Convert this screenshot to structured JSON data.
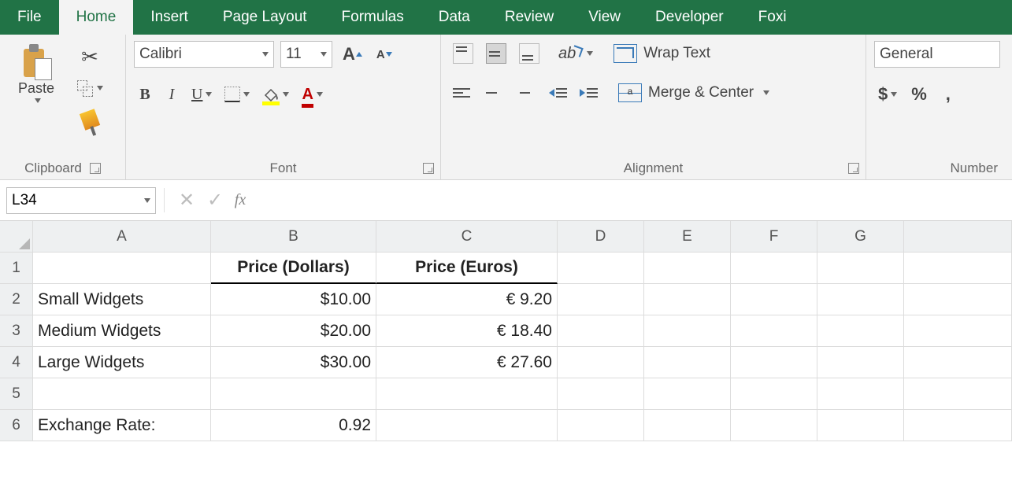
{
  "tabs": {
    "file": "File",
    "home": "Home",
    "insert": "Insert",
    "page_layout": "Page Layout",
    "formulas": "Formulas",
    "data": "Data",
    "review": "Review",
    "view": "View",
    "developer": "Developer",
    "foxit": "Foxi"
  },
  "ribbon": {
    "clipboard": {
      "label": "Clipboard",
      "paste": "Paste"
    },
    "font": {
      "label": "Font",
      "name": "Calibri",
      "size": "11",
      "grow": "A",
      "shrink": "A",
      "bold": "B",
      "italic": "I",
      "underline": "U",
      "font_color_glyph": "A"
    },
    "alignment": {
      "label": "Alignment",
      "wrap": "Wrap Text",
      "merge": "Merge & Center",
      "orient_glyph": "ab"
    },
    "number": {
      "label": "Number",
      "format": "General",
      "currency": "$",
      "percent": "%",
      "comma": ","
    }
  },
  "formula_bar": {
    "name_box": "L34",
    "cancel": "✕",
    "enter": "✓",
    "fx": "fx",
    "value": ""
  },
  "grid": {
    "cols": [
      "A",
      "B",
      "C",
      "D",
      "E",
      "F",
      "G"
    ],
    "rows": [
      "1",
      "2",
      "3",
      "4",
      "5",
      "6"
    ],
    "headers": {
      "b1": "Price (Dollars)",
      "c1": "Price (Euros)"
    },
    "data": {
      "a2": "Small Widgets",
      "b2": "$10.00",
      "c2": "€ 9.20",
      "a3": "Medium Widgets",
      "b3": "$20.00",
      "c3": "€ 18.40",
      "a4": "Large Widgets",
      "b4": "$30.00",
      "c4": "€ 27.60",
      "a6": "Exchange Rate:",
      "b6": "0.92"
    }
  },
  "chart_data": {
    "type": "table",
    "columns": [
      "",
      "Price (Dollars)",
      "Price (Euros)"
    ],
    "rows": [
      [
        "Small Widgets",
        10.0,
        9.2
      ],
      [
        "Medium Widgets",
        20.0,
        18.4
      ],
      [
        "Large Widgets",
        30.0,
        27.6
      ]
    ],
    "footer": {
      "label": "Exchange Rate:",
      "value": 0.92
    }
  }
}
